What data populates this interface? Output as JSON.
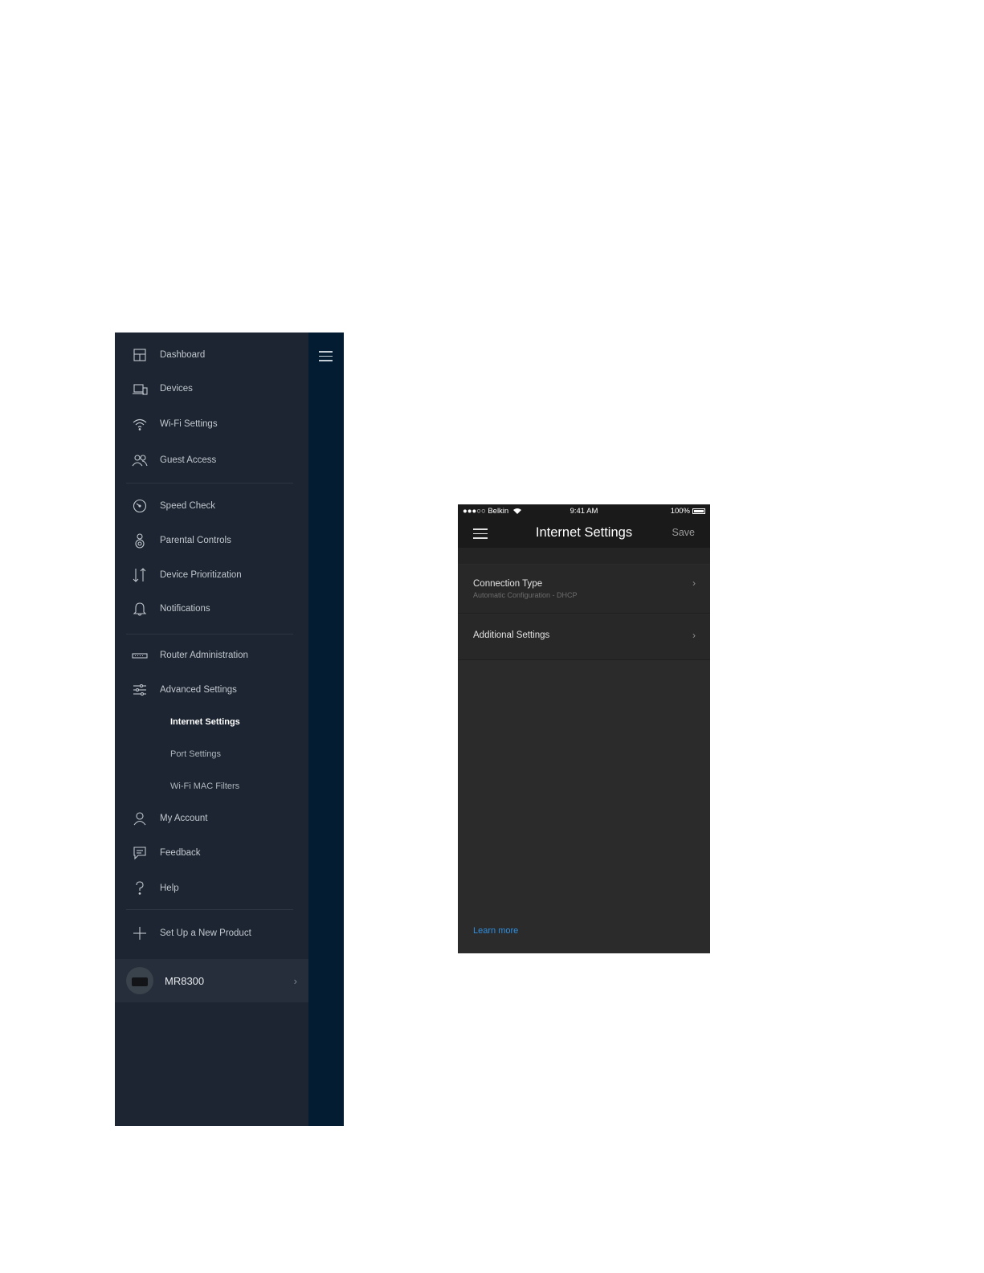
{
  "navigation_drawer": {
    "items": [
      {
        "label": "Dashboard",
        "icon": "dashboard-icon"
      },
      {
        "label": "Devices",
        "icon": "devices-icon"
      },
      {
        "label": "Wi-Fi Settings",
        "icon": "wifi-icon"
      },
      {
        "label": "Guest Access",
        "icon": "guest-access-icon"
      },
      {
        "label": "Speed Check",
        "icon": "speed-check-icon"
      },
      {
        "label": "Parental Controls",
        "icon": "parental-controls-icon"
      },
      {
        "label": "Device Prioritization",
        "icon": "device-prioritization-icon"
      },
      {
        "label": "Notifications",
        "icon": "notifications-bell-icon"
      },
      {
        "label": "Router Administration",
        "icon": "router-icon"
      },
      {
        "label": "Advanced Settings",
        "icon": "sliders-icon"
      },
      {
        "label": "My Account",
        "icon": "account-person-icon"
      },
      {
        "label": "Feedback",
        "icon": "feedback-chat-icon"
      },
      {
        "label": "Help",
        "icon": "help-question-icon"
      },
      {
        "label": "Set Up a New Product",
        "icon": "plus-icon"
      }
    ],
    "advanced_sub_items": [
      {
        "label": "Internet Settings",
        "active": true
      },
      {
        "label": "Port Settings",
        "active": false
      },
      {
        "label": "Wi-Fi MAC Filters",
        "active": false
      }
    ],
    "device": {
      "name": "MR8300",
      "chevron": "›"
    },
    "colors": {
      "panel": "#1c2531",
      "strip": "#031c31",
      "active_text": "#ffffff"
    }
  },
  "phone": {
    "status_bar": {
      "carrier": "●●●○○ Belkin",
      "time": "9:41 AM",
      "battery": "100%"
    },
    "header": {
      "title": "Internet Settings",
      "save_label": "Save"
    },
    "rows": [
      {
        "title": "Connection Type",
        "subtitle": "Automatic Configuration - DHCP",
        "chevron": "›"
      },
      {
        "title": "Additional Settings",
        "chevron": "›"
      }
    ],
    "learn_more": "Learn more",
    "colors": {
      "background": "#2b2b2b",
      "header": "#1a1a1a",
      "link": "#2f8fe0"
    }
  }
}
